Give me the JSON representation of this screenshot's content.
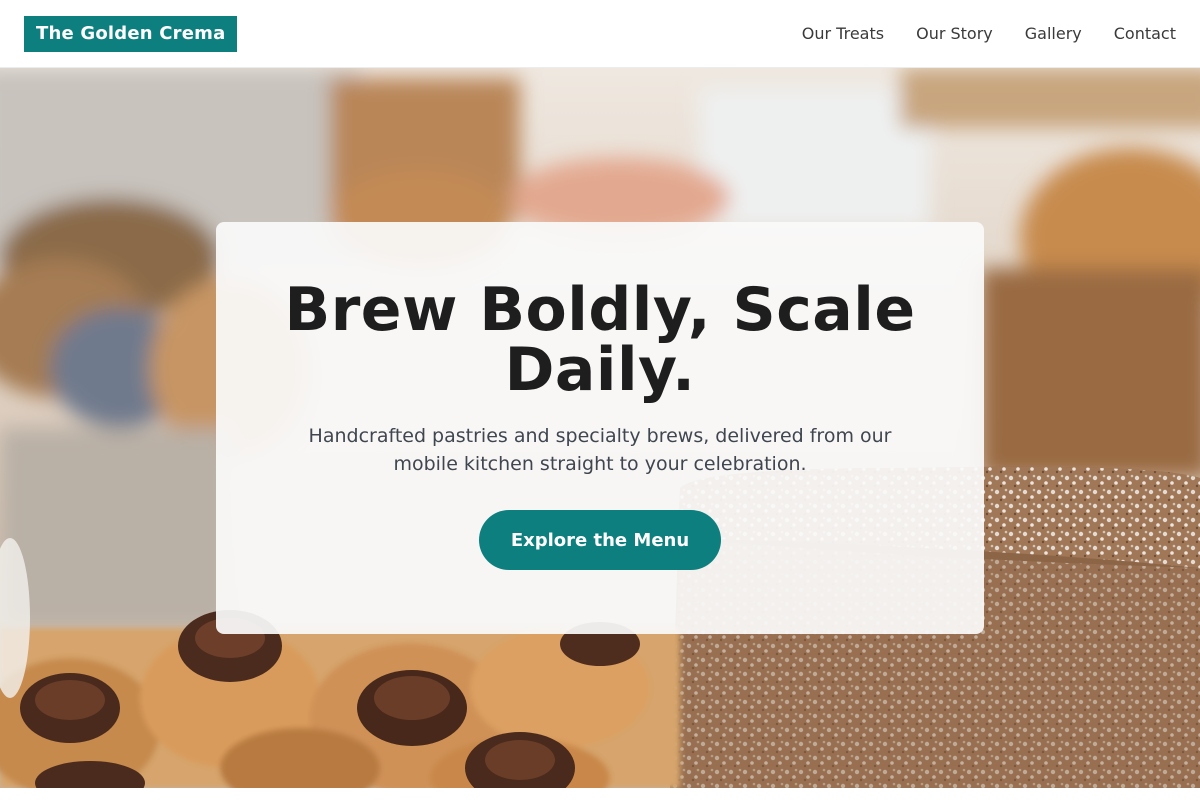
{
  "header": {
    "brand": "The Golden Crema",
    "nav": [
      {
        "label": "Our Treats"
      },
      {
        "label": "Our Story"
      },
      {
        "label": "Gallery"
      },
      {
        "label": "Contact"
      }
    ]
  },
  "hero": {
    "headline": "Brew Boldly, Scale Daily.",
    "subtitle": "Handcrafted pastries and specialty brews, delivered from our mobile kitchen straight to your celebration.",
    "cta_label": "Explore the Menu",
    "background_image": "bakery-pastries-photo"
  },
  "colors": {
    "brand": "#0e7f7f",
    "text_dark": "#1e1e1e",
    "text_muted": "#3f4650"
  }
}
